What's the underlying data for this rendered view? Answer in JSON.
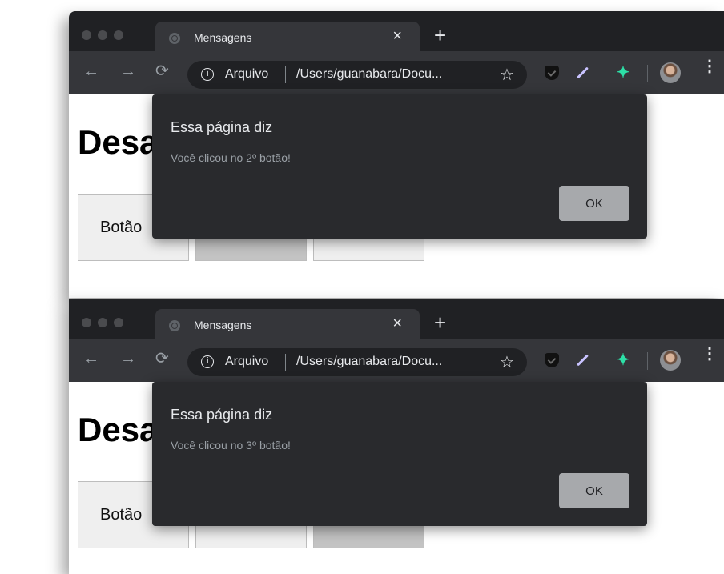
{
  "screens": [
    {
      "tab_title": "Mensagens",
      "tab_close": "×",
      "new_tab": "+",
      "address_scheme": "Arquivo",
      "address_url": "/Users/guanabara/Docu...",
      "page_heading": "Desa",
      "buttons": [
        "Botão",
        "",
        ""
      ],
      "active_button_index": 1,
      "dialog": {
        "title": "Essa página diz",
        "message": "Você clicou no 2º botão!",
        "ok_label": "OK"
      }
    },
    {
      "tab_title": "Mensagens",
      "tab_close": "×",
      "new_tab": "+",
      "address_scheme": "Arquivo",
      "address_url": "/Users/guanabara/Docu...",
      "page_heading": "Desa",
      "buttons": [
        "Botão",
        "",
        ""
      ],
      "active_button_index": 2,
      "dialog": {
        "title": "Essa página diz",
        "message": "Você clicou no 3º botão!",
        "ok_label": "OK"
      }
    }
  ],
  "icons": {
    "back": "←",
    "forward": "→",
    "reload": "⟳",
    "info": "i",
    "bookmark": "☆",
    "menu": "⋮"
  },
  "colors": {
    "tab_strip": "#202124",
    "toolbar": "#35363a",
    "dialog_bg": "#292a2d",
    "ok_button": "#a7a9ac",
    "active_page_button": "#c3c3c3",
    "extension_green": "#2de0a7"
  }
}
